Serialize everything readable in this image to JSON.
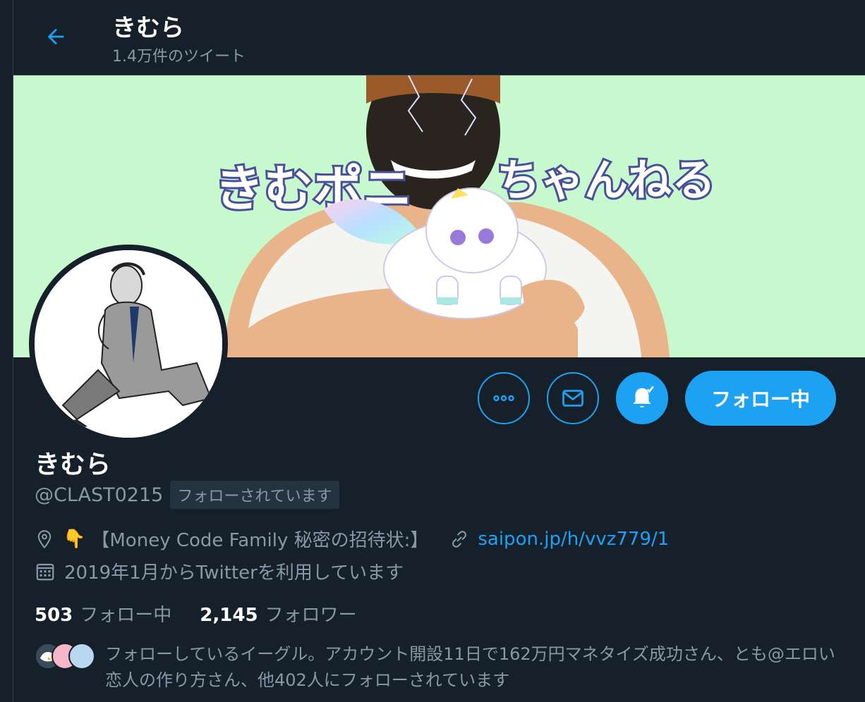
{
  "header": {
    "title": "きむら",
    "tweet_count": "1.4万件のツイート",
    "back_icon": "arrow-left-icon"
  },
  "banner": {
    "text_left": "きむポニ",
    "text_right": "ちゃんねる",
    "background_color": "#c8f8cd"
  },
  "actions": {
    "more_icon": "more-icon",
    "message_icon": "mail-icon",
    "notify_icon": "bell-icon",
    "follow_label": "フォロー中"
  },
  "profile": {
    "name": "きむら",
    "handle": "@CLAST0215",
    "follows_you": "フォローされています",
    "location_prefix": "👇",
    "location": "【Money Code Family 秘密の招待状:】",
    "link": "saipon.jp/h/vvz779/1",
    "joined": "2019年1月からTwitterを利用しています"
  },
  "stats": {
    "following_count": "503",
    "following_label": "フォロー中",
    "followers_count": "2,145",
    "followers_label": "フォロワー"
  },
  "mutual": {
    "text": "フォローしているイーグル。アカウント開設11日で162万円マネタイズ成功さん、とも@エロい恋人の作り方さん、他402人にフォローされています"
  },
  "colors": {
    "background": "#15202b",
    "accent": "#1da1f2",
    "secondary_text": "#8899a6",
    "border": "#38444d"
  }
}
